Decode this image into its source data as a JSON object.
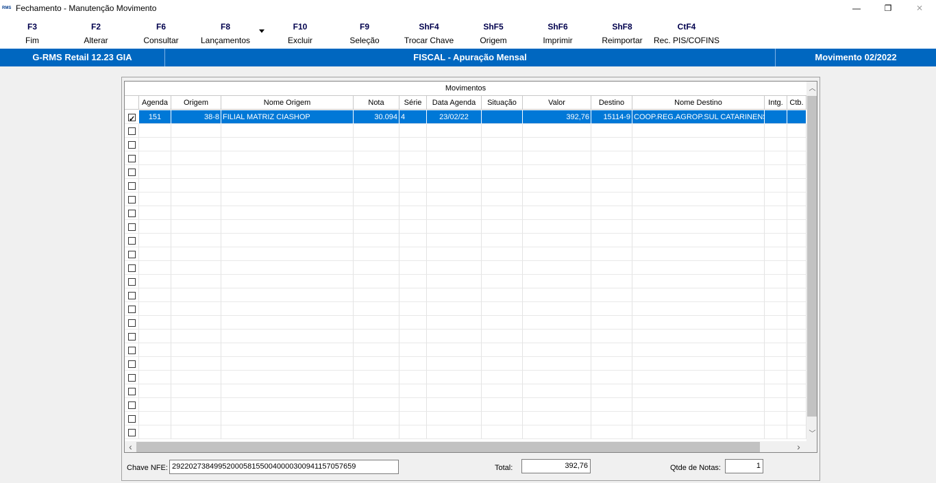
{
  "window": {
    "title": "Fechamento - Manutenção Movimento",
    "app_icon_text": "RMS",
    "minimize_icon": "—",
    "maximize_icon": "❐",
    "close_icon": "✕"
  },
  "toolbar": [
    {
      "key": "F3",
      "label": "Fim"
    },
    {
      "key": "F2",
      "label": "Alterar"
    },
    {
      "key": "F6",
      "label": "Consultar"
    },
    {
      "key": "F8",
      "label": "Lançamentos"
    },
    {
      "key": "F10",
      "label": "Excluir"
    },
    {
      "key": "F9",
      "label": "Seleção"
    },
    {
      "key": "ShF4",
      "label": "Trocar Chave"
    },
    {
      "key": "ShF5",
      "label": "Origem"
    },
    {
      "key": "ShF6",
      "label": "Imprimir"
    },
    {
      "key": "ShF8",
      "label": "Reimportar"
    },
    {
      "key": "CtF4",
      "label": "Rec. PIS/COFINS"
    }
  ],
  "statusbar": {
    "system": "G-RMS Retail 12.23 GIA",
    "module": "FISCAL - Apuração Mensal",
    "period": "Movimento 02/2022"
  },
  "grid": {
    "caption": "Movimentos",
    "columns": [
      "Agenda",
      "Origem",
      "Nome Origem",
      "Nota",
      "Série",
      "Data Agenda",
      "Situação",
      "Valor",
      "Destino",
      "Nome Destino",
      "Intg.",
      "Ctb."
    ],
    "rows": [
      {
        "checked": true,
        "agenda": "151",
        "origem": "38-8",
        "nome_origem": "FILIAL MATRIZ CIASHOP",
        "nota": "30.094",
        "serie": "4",
        "data_agenda": "23/02/22",
        "situacao": "",
        "valor": "392,76",
        "destino": "15114-9",
        "nome_destino": "COOP.REG.AGROP.SUL CATARINENSE",
        "intg": "",
        "ctb": ""
      }
    ],
    "empty_rows": 23,
    "scroll_up": "︿",
    "scroll_down": "﹀",
    "scroll_left": "‹",
    "scroll_right": "›"
  },
  "footer": {
    "chave_label": "Chave NFE:",
    "chave_value": "29220273849952000581550040000300941157057659",
    "total_label": "Total:",
    "total_value": "392,76",
    "qtde_label": "Qtde de Notas:",
    "qtde_value": "1"
  }
}
